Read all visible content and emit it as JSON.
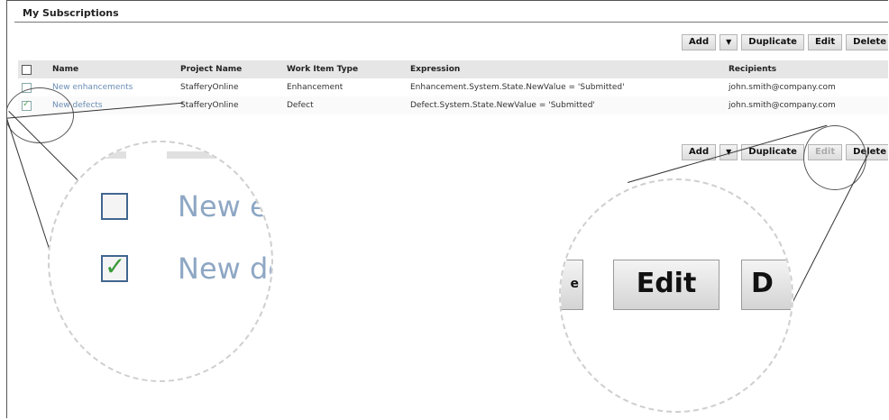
{
  "page": {
    "title": "My Subscriptions"
  },
  "toolbar": {
    "add_label": "Add",
    "caret": "▼",
    "duplicate_label": "Duplicate",
    "edit_label": "Edit",
    "delete_label": "Delete"
  },
  "table": {
    "headers": [
      "Name",
      "Project Name",
      "Work Item Type",
      "Expression",
      "Recipients"
    ],
    "rows": [
      {
        "name": "New enhancements",
        "project": "StafferyOnline",
        "type": "Enhancement",
        "expression": "Enhancement.System.State.NewValue = 'Submitted'",
        "recipients": "john.smith@company.com",
        "checked": false
      },
      {
        "name": "New defects",
        "project": "StafferyOnline",
        "type": "Defect",
        "expression": "Defect.System.State.NewValue = 'Submitted'",
        "recipients": "john.smith@company.com",
        "checked": true
      }
    ]
  },
  "zoom_left": {
    "row1_text": "New en",
    "row2_text": "New defe"
  },
  "zoom_right": {
    "prev_fragment": "e",
    "edit_label": "Edit",
    "next_fragment": "D"
  },
  "colors": {
    "link": "#6a8db4",
    "checkmark": "#3a9a3a",
    "header_bg": "#e6e6e6"
  }
}
